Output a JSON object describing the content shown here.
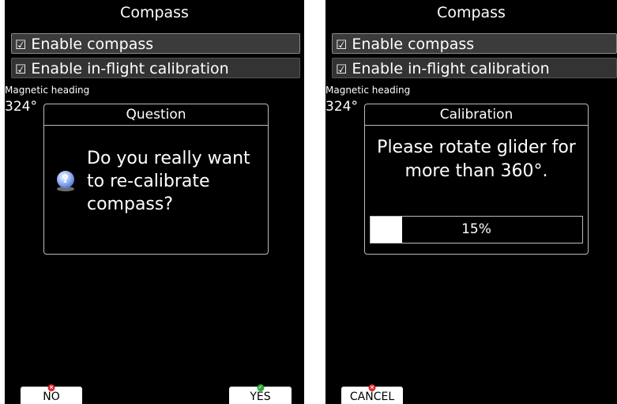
{
  "left": {
    "title": "Compass",
    "enable_compass": "Enable compass",
    "enable_inflight": "Enable in-flight calibration",
    "magnetic_heading_label": "Magnetic heading",
    "heading_value": "324°",
    "dialog": {
      "title": "Question",
      "text": "Do you really want to re-calibrate compass?"
    },
    "softkeys": {
      "no": "NO",
      "yes": "YES"
    }
  },
  "right": {
    "title": "Compass",
    "enable_compass": "Enable compass",
    "enable_inflight": "Enable in-flight calibration",
    "magnetic_heading_label": "Magnetic heading",
    "heading_value": "324°",
    "dialog": {
      "title": "Calibration",
      "text": "Please rotate glider for more than 360°.",
      "progress_label": "15%",
      "progress": 0.15
    },
    "softkeys": {
      "cancel": "CANCEL"
    }
  },
  "colors": {
    "background": "#000000",
    "progress_fill": "#ffffff",
    "no_mark": "#d8262a",
    "yes_mark": "#2fa535"
  },
  "icons": {
    "checkbox": "☑",
    "question": "question-icon",
    "x_mark": "x-mark-icon",
    "check_mark": "check-mark-icon"
  }
}
